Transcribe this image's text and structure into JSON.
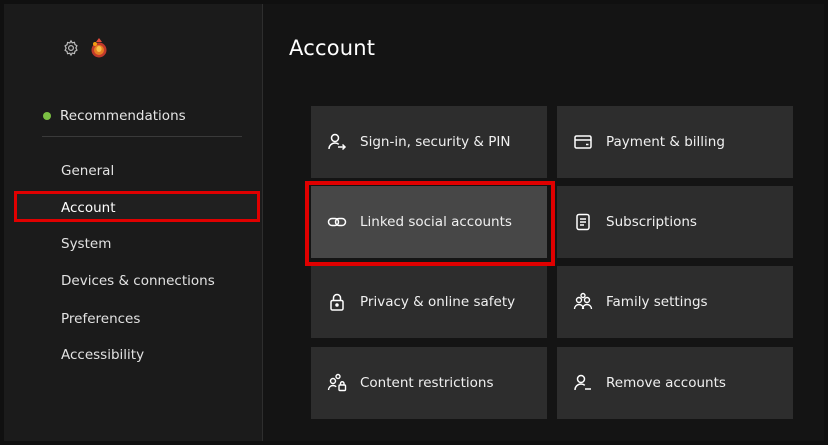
{
  "sidebar": {
    "icons": [
      "gear-icon",
      "avatar"
    ],
    "recommendations": {
      "label": "Recommendations",
      "dot_color": "#7bc043"
    },
    "items": [
      {
        "label": "General"
      },
      {
        "label": "Account",
        "selected": true
      },
      {
        "label": "System"
      },
      {
        "label": "Devices & connections"
      },
      {
        "label": "Preferences"
      },
      {
        "label": "Accessibility"
      }
    ]
  },
  "main": {
    "title": "Account",
    "tiles": [
      {
        "label": "Sign-in, security & PIN",
        "icon": "person-arrow-icon"
      },
      {
        "label": "Payment & billing",
        "icon": "credit-card-icon"
      },
      {
        "label": "Linked social accounts",
        "icon": "link-icon",
        "focused": true
      },
      {
        "label": "Subscriptions",
        "icon": "subscriptions-icon"
      },
      {
        "label": "Privacy & online safety",
        "icon": "lock-icon"
      },
      {
        "label": "Family settings",
        "icon": "family-icon"
      },
      {
        "label": "Content restrictions",
        "icon": "family-lock-icon"
      },
      {
        "label": "Remove accounts",
        "icon": "person-remove-icon"
      }
    ]
  },
  "colors": {
    "highlight": "#e00000",
    "tile_bg": "#2d2d2d",
    "tile_focused_bg": "#474747",
    "sidebar_bg": "#1b1b1b",
    "status_green": "#7bc043"
  }
}
